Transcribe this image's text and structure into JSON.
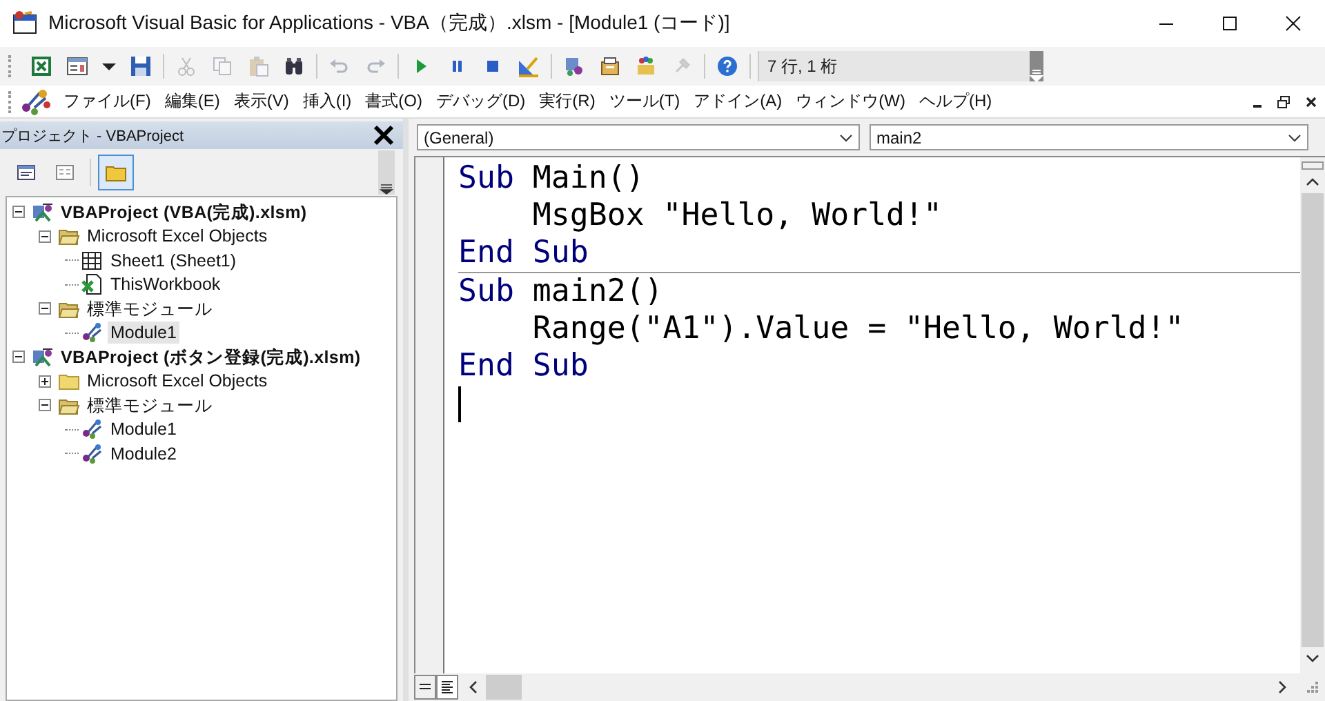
{
  "window": {
    "title": "Microsoft Visual Basic for Applications - VBA（完成）.xlsm - [Module1 (コード)]"
  },
  "toolbar": {
    "groups": [
      [
        {
          "kind": "excel",
          "disabled": false
        },
        {
          "kind": "userform",
          "disabled": false
        },
        {
          "kind": "dropdown",
          "disabled": false
        },
        {
          "kind": "save",
          "disabled": false
        }
      ],
      [
        {
          "kind": "cut",
          "disabled": true
        },
        {
          "kind": "copy",
          "disabled": true
        },
        {
          "kind": "paste",
          "disabled": true
        },
        {
          "kind": "find",
          "disabled": false
        }
      ],
      [
        {
          "kind": "undo",
          "disabled": true
        },
        {
          "kind": "redo",
          "disabled": true
        }
      ],
      [
        {
          "kind": "run",
          "disabled": false
        },
        {
          "kind": "pause",
          "disabled": false
        },
        {
          "kind": "stop",
          "disabled": false
        },
        {
          "kind": "design",
          "disabled": false
        }
      ],
      [
        {
          "kind": "explorer",
          "disabled": false
        },
        {
          "kind": "properties",
          "disabled": false
        },
        {
          "kind": "browser",
          "disabled": false
        },
        {
          "kind": "toolbox",
          "disabled": true
        }
      ],
      [
        {
          "kind": "help",
          "disabled": false
        }
      ]
    ],
    "position": "7 行, 1 桁"
  },
  "menu": [
    "ファイル(F)",
    "編集(E)",
    "表示(V)",
    "挿入(I)",
    "書式(O)",
    "デバッグ(D)",
    "実行(R)",
    "ツール(T)",
    "アドイン(A)",
    "ウィンドウ(W)",
    "ヘルプ(H)"
  ],
  "project_panel": {
    "title": "プロジェクト - VBAProject",
    "buttons": [
      {
        "kind": "view-code",
        "selected": false
      },
      {
        "kind": "view-object",
        "selected": false
      },
      {
        "kind": "toggle-folders",
        "selected": true
      }
    ],
    "tree": [
      {
        "label": "VBAProject (VBA(完成).xlsm)",
        "kind": "project",
        "expanded": true,
        "selected": false,
        "children": [
          {
            "label": "Microsoft Excel Objects",
            "kind": "folder",
            "expanded": true,
            "selected": false,
            "children": [
              {
                "label": "Sheet1 (Sheet1)",
                "kind": "sheet",
                "selected": false
              },
              {
                "label": "ThisWorkbook",
                "kind": "workbook",
                "selected": false
              }
            ]
          },
          {
            "label": "標準モジュール",
            "kind": "folder",
            "expanded": true,
            "selected": false,
            "children": [
              {
                "label": "Module1",
                "kind": "module",
                "selected": true
              }
            ]
          }
        ]
      },
      {
        "label": "VBAProject (ボタン登録(完成).xlsm)",
        "kind": "project",
        "expanded": true,
        "selected": false,
        "children": [
          {
            "label": "Microsoft Excel Objects",
            "kind": "folder",
            "expanded": false,
            "selected": false
          },
          {
            "label": "標準モジュール",
            "kind": "folder",
            "expanded": true,
            "selected": false,
            "children": [
              {
                "label": "Module1",
                "kind": "module",
                "selected": false
              },
              {
                "label": "Module2",
                "kind": "module",
                "selected": false
              }
            ]
          }
        ]
      }
    ]
  },
  "code_window": {
    "object": "(General)",
    "procedure": "main2",
    "procedures": [
      {
        "lines": [
          {
            "cursor": false,
            "tokens": [
              {
                "kind": "keyword",
                "text": "Sub"
              },
              {
                "kind": "plain",
                "text": " Main()"
              }
            ]
          },
          {
            "cursor": false,
            "tokens": [
              {
                "kind": "plain",
                "text": "    MsgBox \"Hello, World!\""
              }
            ]
          },
          {
            "cursor": false,
            "tokens": [
              {
                "kind": "keyword",
                "text": "End Sub"
              }
            ]
          }
        ]
      },
      {
        "lines": [
          {
            "cursor": false,
            "tokens": [
              {
                "kind": "keyword",
                "text": "Sub"
              },
              {
                "kind": "plain",
                "text": " main2()"
              }
            ]
          },
          {
            "cursor": false,
            "tokens": [
              {
                "kind": "plain",
                "text": "    Range(\"A1\").Value = \"Hello, World!\""
              }
            ]
          },
          {
            "cursor": false,
            "tokens": [
              {
                "kind": "keyword",
                "text": "End Sub"
              }
            ]
          },
          {
            "cursor": true
          }
        ]
      }
    ]
  }
}
